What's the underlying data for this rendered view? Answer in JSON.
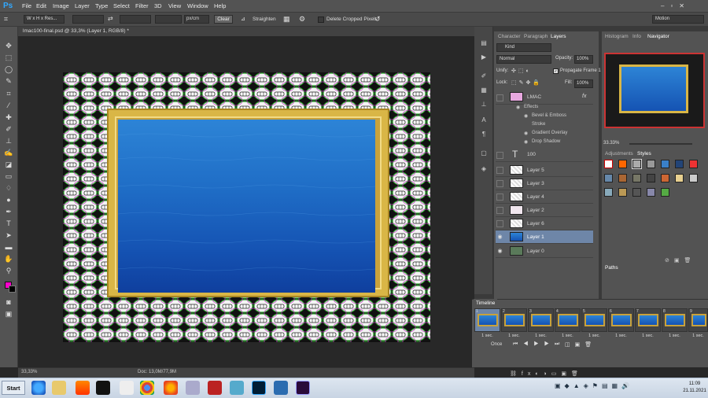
{
  "app": {
    "logo": "Ps"
  },
  "menu": [
    "File",
    "Edit",
    "Image",
    "Layer",
    "Type",
    "Select",
    "Filter",
    "3D",
    "View",
    "Window",
    "Help"
  ],
  "options": {
    "ratio": "W x H x Res...",
    "unit": "px/cm",
    "clear": "Clear",
    "straighten": "Straighten",
    "delete_cropped": "Delete Cropped Pixels",
    "workspace": "Motion"
  },
  "document": {
    "tab": "lmac100-final.psd @ 33,3% (Layer 1, RGB/8) *",
    "zoom": "33,33%",
    "doc_size": "Doc: 13,0M/77,9M"
  },
  "panels": {
    "tabs": [
      "Character",
      "Paragraph",
      "Layers"
    ],
    "nav_tabs": [
      "Histogram",
      "Info",
      "Navigator"
    ],
    "adj_tabs": [
      "Adjustments",
      "Styles"
    ],
    "paths_tab": "Paths",
    "timeline_tab": "Timeline"
  },
  "layers": {
    "kind": "Kind",
    "blend": "Normal",
    "opacity_label": "Opacity:",
    "opacity": "100%",
    "unify": "Unify:",
    "propagate": "Propagate Frame 1",
    "lock": "Lock:",
    "fill_label": "Fill:",
    "fill": "100%",
    "items": [
      {
        "name": "LMAC",
        "fx": "fx"
      },
      {
        "name": "Effects"
      },
      {
        "name": "Bevel & Emboss"
      },
      {
        "name": "Stroke"
      },
      {
        "name": "Gradient Overlay"
      },
      {
        "name": "Drop Shadow"
      },
      {
        "name": "100"
      },
      {
        "name": "Layer 5"
      },
      {
        "name": "Layer 3"
      },
      {
        "name": "Layer 4"
      },
      {
        "name": "Layer 2"
      },
      {
        "name": "Layer 6"
      },
      {
        "name": "Layer 1"
      },
      {
        "name": "Layer 0"
      }
    ]
  },
  "navigator": {
    "zoom": "33.33%"
  },
  "timeline": {
    "frames": [
      "1",
      "2",
      "3",
      "4",
      "5",
      "6",
      "7",
      "8",
      "9"
    ],
    "delay": "1 sec.",
    "loop": "Once"
  },
  "taskbar": {
    "start": "Start",
    "time": "11:09",
    "date": "21.11.2021"
  }
}
